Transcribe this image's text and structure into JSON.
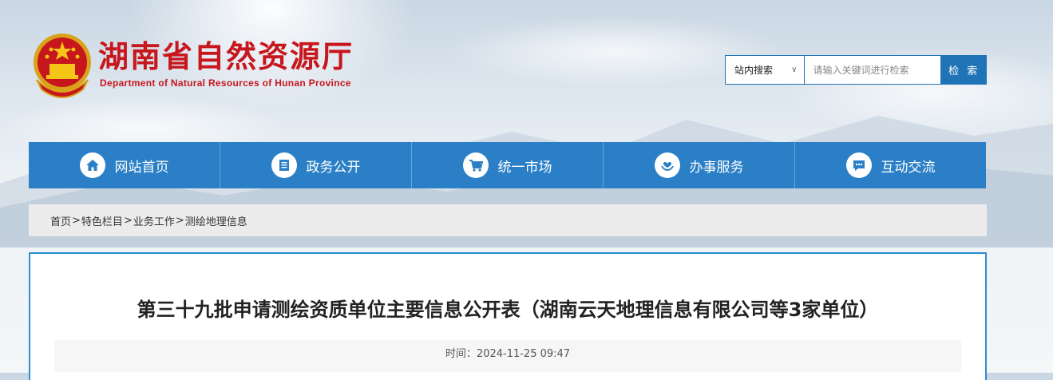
{
  "header": {
    "title_cn": "湖南省自然资源厅",
    "title_en": "Department of Natural Resources of Hunan Province"
  },
  "search": {
    "scope": "站内搜索",
    "placeholder": "请输入关键词进行检索",
    "button": "检 索"
  },
  "nav": {
    "items": [
      {
        "label": "网站首页",
        "icon": "home-icon"
      },
      {
        "label": "政务公开",
        "icon": "document-icon"
      },
      {
        "label": "统一市场",
        "icon": "cart-icon"
      },
      {
        "label": "办事服务",
        "icon": "heart-hand-icon"
      },
      {
        "label": "互动交流",
        "icon": "chat-icon"
      }
    ]
  },
  "breadcrumb": {
    "items": [
      "首页",
      "特色栏目",
      "业务工作",
      "测绘地理信息"
    ],
    "separator": ">"
  },
  "article": {
    "title": "第三十九批申请测绘资质单位主要信息公开表（湖南云天地理信息有限公司等3家单位）",
    "meta": "时间：2024-11-25 09:47"
  },
  "colors": {
    "brand_red": "#c8161d",
    "nav_blue": "#2a7fc6",
    "border_blue": "#2a90cf"
  }
}
